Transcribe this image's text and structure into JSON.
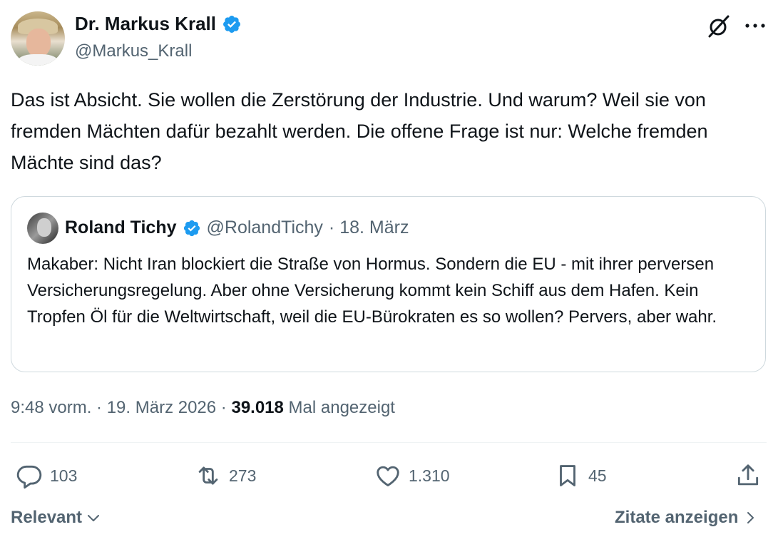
{
  "author": {
    "name": "Dr. Markus Krall",
    "handle": "@Markus_Krall",
    "verified": true
  },
  "tweet": {
    "text": "Das ist Absicht. Sie wollen die Zerstörung der Industrie. Und warum? Weil sie von fremden Mächten dafür bezahlt werden. Die offene Frage ist nur: Welche fremden Mächte sind das?"
  },
  "quoted": {
    "name": "Roland Tichy",
    "handle": "@RolandTichy",
    "date": "· 18. März",
    "text": "Makaber: Nicht Iran blockiert die Straße von Hormus. Sondern die EU - mit ihrer perversen Versicherungsregelung. Aber ohne Versicherung kommt kein Schiff aus dem Hafen. Kein Tropfen Öl für die Weltwirtschaft, weil die EU-Bürokraten es so wollen? Pervers, aber wahr."
  },
  "meta": {
    "time": "9:48 vorm. · 19. März 2026 · ",
    "views": "39.018",
    "views_label": " Mal angezeigt"
  },
  "actions": {
    "replies": "103",
    "reposts": "273",
    "likes": "1.310",
    "bookmarks": "45"
  },
  "footer": {
    "sort_label": "Relevant",
    "quotes_label": "Zitate anzeigen"
  },
  "colors": {
    "verified": "#1d9bf0",
    "secondary_text": "#536471",
    "border": "#cfd9de"
  },
  "icons": [
    "grok-icon",
    "more-icon",
    "verified-icon",
    "reply-icon",
    "repost-icon",
    "like-icon",
    "bookmark-icon",
    "share-icon",
    "chevron-down-icon",
    "chevron-right-icon"
  ]
}
